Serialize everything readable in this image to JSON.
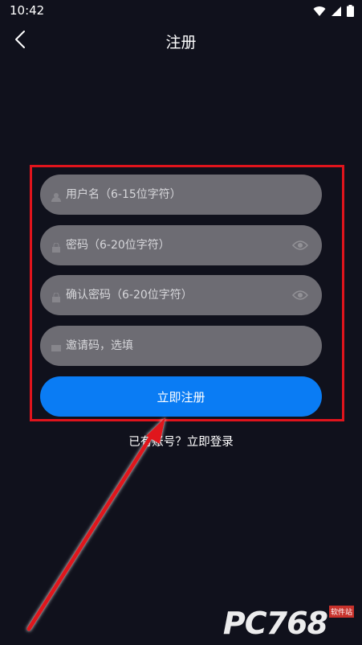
{
  "status_bar": {
    "time": "10:42"
  },
  "nav": {
    "title": "注册",
    "back_icon": "chevron-left-icon"
  },
  "form": {
    "username_placeholder": "用户名（6-15位字符）",
    "password_placeholder": "密码（6-20位字符）",
    "confirm_password_placeholder": "确认密码（6-20位字符）",
    "invite_code_placeholder": "邀请码，选填",
    "register_label": "立即注册"
  },
  "login": {
    "prompt": "已有账号？",
    "link_label": "立即登录"
  },
  "watermark": {
    "main": "PC768",
    "sub": "软件站"
  },
  "colors": {
    "background": "#10111c",
    "field": "#6d6c73",
    "primary": "#0a7cf4",
    "annotation": "#e0141c"
  }
}
